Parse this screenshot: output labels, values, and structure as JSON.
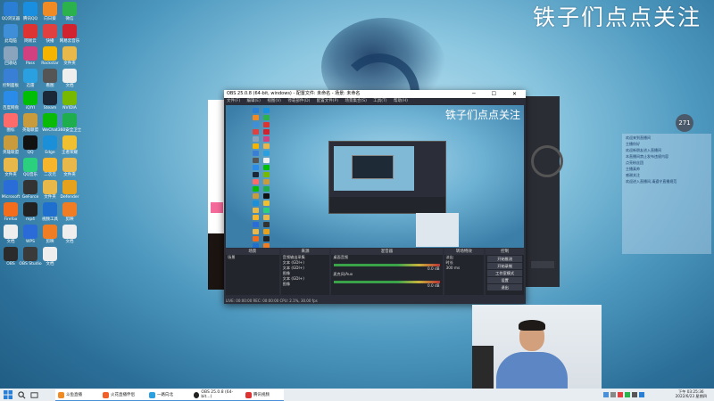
{
  "banner_text": "铁子们点点关注",
  "desktop_icons": [
    {
      "label": "QQ浏览器",
      "color": "#2a7fd4"
    },
    {
      "label": "腾讯QQ",
      "color": "#1a8fe0"
    },
    {
      "label": "向日葵",
      "color": "#f08a24"
    },
    {
      "label": "微信",
      "color": "#2bb24c"
    },
    {
      "label": "此电脑",
      "color": "#3f8fd8"
    },
    {
      "label": "网易云",
      "color": "#d33"
    },
    {
      "label": "快播",
      "color": "#e04040"
    },
    {
      "label": "网易云音乐",
      "color": "#d0232f"
    },
    {
      "label": "回收站",
      "color": "#8aa4bd"
    },
    {
      "label": "Pass",
      "color": "#d24080"
    },
    {
      "label": "Rockstar",
      "color": "#f4b400"
    },
    {
      "label": "文件夹",
      "color": "#e8b84a"
    },
    {
      "label": "控制面板",
      "color": "#3a7fd6"
    },
    {
      "label": "迅雷",
      "color": "#2aa0e0"
    },
    {
      "label": "看图",
      "color": "#555"
    },
    {
      "label": "文档",
      "color": "#eee"
    },
    {
      "label": "百度网盘",
      "color": "#2a8be8"
    },
    {
      "label": "iQIYI",
      "color": "#00be06"
    },
    {
      "label": "Steam",
      "color": "#1b2838"
    },
    {
      "label": "NVIDIA",
      "color": "#76b900"
    },
    {
      "label": "图标",
      "color": "#ff6a6a"
    },
    {
      "label": "英雄联盟",
      "color": "#c89b3c"
    },
    {
      "label": "WeChat",
      "color": "#09bb07"
    },
    {
      "label": "360安全卫士",
      "color": "#1fae4d"
    },
    {
      "label": "英雄联盟",
      "color": "#c89b3c"
    },
    {
      "label": "QQ",
      "color": "#111"
    },
    {
      "label": "Edge",
      "color": "#1c8fd9"
    },
    {
      "label": "王者荣耀",
      "color": "#f0c030"
    },
    {
      "label": "文件夹",
      "color": "#e8b84a"
    },
    {
      "label": "QQ音乐",
      "color": "#2bd07e"
    },
    {
      "label": "二次元",
      "color": "#f7b52c"
    },
    {
      "label": "文件夹",
      "color": "#e8b84a"
    },
    {
      "label": "Microsoft",
      "color": "#2a6dd8"
    },
    {
      "label": "GeForce",
      "color": "#333"
    },
    {
      "label": "文件夹",
      "color": "#e8b84a"
    },
    {
      "label": "Defender",
      "color": "#e6a21c"
    },
    {
      "label": "Firefox",
      "color": "#f36d1d"
    },
    {
      "label": "mp4",
      "color": "#222"
    },
    {
      "label": "视频工具",
      "color": "#1f6fcf"
    },
    {
      "label": "剪映",
      "color": "#f07d24"
    },
    {
      "label": "文档",
      "color": "#eee"
    },
    {
      "label": "WPS",
      "color": "#2a6bd8"
    },
    {
      "label": "剪映",
      "color": "#f07d24"
    },
    {
      "label": "文档",
      "color": "#eee"
    },
    {
      "label": "OBS",
      "color": "#2b2b2b"
    },
    {
      "label": "OBS Studio",
      "color": "#3a3a3a"
    },
    {
      "label": "文档",
      "color": "#eee"
    }
  ],
  "obs": {
    "title": "OBS 25.0.8 (64-bit, windows) - 配置文件: 未命名 - 场景: 未命名",
    "menu": [
      "文件(F)",
      "编辑(E)",
      "视图(V)",
      "停靠部件(D)",
      "配置文件(P)",
      "场景集合(S)",
      "工具(T)",
      "帮助(H)"
    ],
    "preview_text": "铁子们点点关注",
    "docks": {
      "scenes": {
        "title": "场景",
        "items": [
          "场景"
        ]
      },
      "sources": {
        "title": "来源",
        "items": [
          "音频输出采集",
          "文本 (GDI+)",
          "文本 (GDI+)",
          "图像",
          "文本 (GDI+)",
          "图像"
        ]
      },
      "mixer": {
        "title": "混音器",
        "channels": [
          "桌面音频",
          "麦克风/Aux"
        ],
        "levels": [
          "0.0 dB",
          "0.0 dB"
        ]
      },
      "transitions": {
        "title": "转场特效",
        "type": "淡出",
        "duration_label": "时长",
        "duration": "300 ms"
      },
      "controls": {
        "title": "控制",
        "buttons": [
          "开始推流",
          "开始录制",
          "工作室模式",
          "设置",
          "退出"
        ]
      }
    },
    "status": "LIVE: 00:00:00   REC: 00:00:00   CPU: 2.1%, 30.00 fps"
  },
  "chat": {
    "badge": "271",
    "lines": [
      "欢迎来到直播间",
      "主播你好",
      "欢迎新朋友进入直播间",
      "本直播间禁止发布违规内容",
      "点亮粉丝团",
      "主播真帅",
      "感谢关注",
      "欢迎进入直播间,请遵守直播规范"
    ]
  },
  "taskbar": {
    "apps": [
      "斗鱼直播",
      "火花直播伴侣",
      "一路向北",
      "OBS 25.0.8 (64-bit...)",
      "腾讯视频"
    ],
    "time": "下午 03:25:36",
    "date": "2022/6/23 星期四"
  }
}
